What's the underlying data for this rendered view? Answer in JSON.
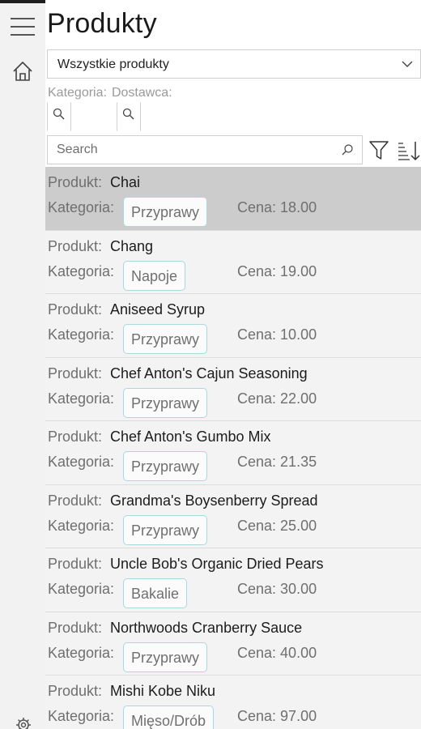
{
  "nav": {
    "menu_icon": "hamburger-icon",
    "home_icon": "home-icon",
    "settings_icon": "gear-icon"
  },
  "page": {
    "title": "Produkty"
  },
  "view_selector": {
    "selected": "Wszystkie produkty"
  },
  "filters": {
    "category_label": "Kategoria:",
    "supplier_label": "Dostawca:"
  },
  "search": {
    "placeholder": "Search"
  },
  "labels": {
    "product": "Produkt:",
    "category": "Kategoria:",
    "price": "Cena:"
  },
  "products": [
    {
      "name": "Chai",
      "category": "Przyprawy",
      "price": "18.00",
      "selected": true
    },
    {
      "name": "Chang",
      "category": "Napoje",
      "price": "19.00"
    },
    {
      "name": "Aniseed Syrup",
      "category": "Przyprawy",
      "price": "10.00"
    },
    {
      "name": "Chef Anton's Cajun Seasoning",
      "category": "Przyprawy",
      "price": "22.00"
    },
    {
      "name": "Chef Anton's Gumbo Mix",
      "category": "Przyprawy",
      "price": "21.35"
    },
    {
      "name": "Grandma's Boysenberry Spread",
      "category": "Przyprawy",
      "price": "25.00"
    },
    {
      "name": "Uncle Bob's Organic Dried Pears",
      "category": "Bakalie",
      "price": "30.00"
    },
    {
      "name": "Northwoods Cranberry Sauce",
      "category": "Przyprawy",
      "price": "40.00"
    },
    {
      "name": "Mishi Kobe Niku",
      "category": "Mięso/Drób",
      "price": "97.00"
    }
  ],
  "colors": {
    "rail_bg": "#f2f2f2",
    "item_bg": "#f3f3f3",
    "selected_bg": "#cccccc",
    "badge_border": "#a9d9dc"
  }
}
